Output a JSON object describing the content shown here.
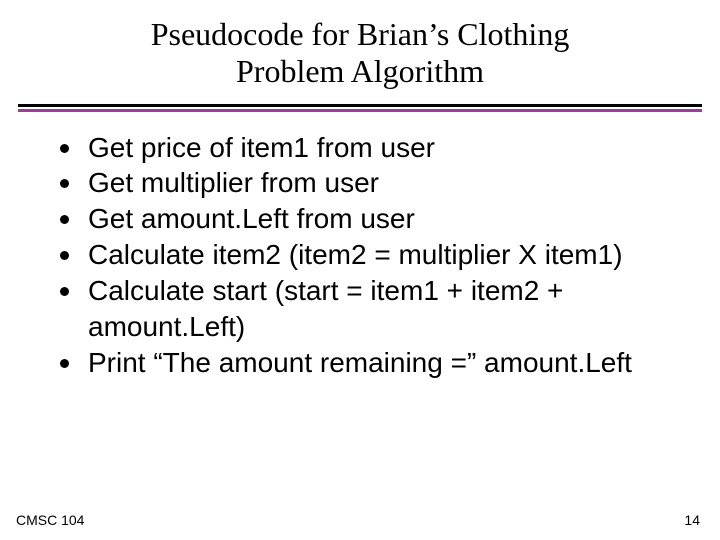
{
  "title_line1": "Pseudocode for Brian’s Clothing",
  "title_line2": "Problem Algorithm",
  "bullets": [
    "Get price of item1 from user",
    "Get multiplier from user",
    "Get amount.Left from user",
    "Calculate item2 (item2 = multiplier X item1)",
    "Calculate start (start = item1 + item2 + amount.Left)",
    "Print “The amount remaining =” amount.Left"
  ],
  "footer_left": "CMSC 104",
  "footer_right": "14"
}
